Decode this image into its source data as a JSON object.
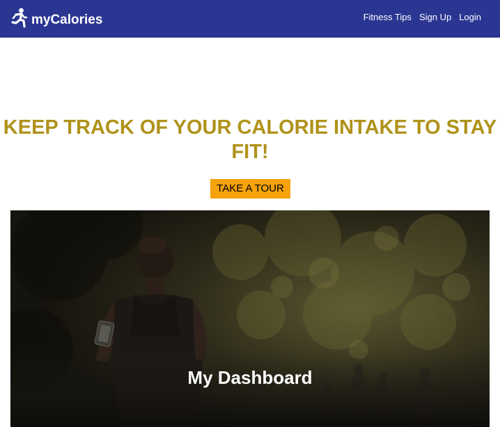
{
  "navbar": {
    "brand_icon": "runner-icon",
    "brand_name": "myCalories",
    "background_color": "#2b3592",
    "links": [
      {
        "label": "Fitness Tips"
      },
      {
        "label": "Sign Up"
      },
      {
        "label": "Login"
      }
    ]
  },
  "hero": {
    "heading": "KEEP TRACK OF YOUR CALORIE INTAKE TO STAY FIT!",
    "heading_color": "#b0921a",
    "tour_button_label": "TAKE A TOUR",
    "tour_button_color": "#f5a20b"
  },
  "dashboard_panel": {
    "title": "My Dashboard",
    "image_subject": "woman-running-in-park-photo"
  }
}
